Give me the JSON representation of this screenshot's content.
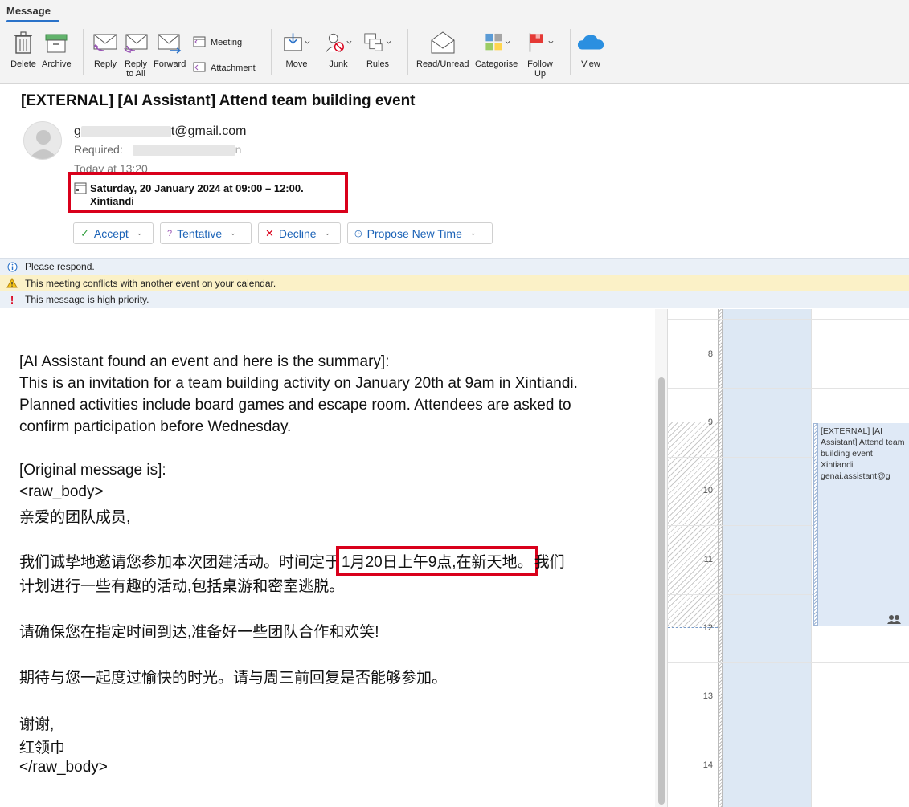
{
  "ribbon": {
    "tab": "Message",
    "buttons": {
      "delete": "Delete",
      "archive": "Archive",
      "reply": "Reply",
      "reply_all": "Reply\nto All",
      "reply_all_1": "Reply",
      "reply_all_2": "to All",
      "forward": "Forward",
      "meeting": "Meeting",
      "attachment": "Attachment",
      "move": "Move",
      "junk": "Junk",
      "rules": "Rules",
      "read_unread": "Read/Unread",
      "categorise": "Categorise",
      "follow_up_1": "Follow",
      "follow_up_2": "Up",
      "view": "View"
    }
  },
  "message": {
    "subject": "[EXTERNAL] [AI Assistant] Attend team building event",
    "sender_suffix": "t@gmail.com",
    "sender_prefix": "g",
    "required_label": "Required:",
    "required_suffix": "n",
    "sent_time": "Today at 13:20",
    "event_datetime": "Saturday, 20 January 2024 at 09:00 – 12:00.",
    "event_location": "Xintiandi"
  },
  "responses": {
    "accept": "Accept",
    "tentative": "Tentative",
    "decline": "Decline",
    "propose": "Propose New Time"
  },
  "infobars": {
    "respond": "Please respond.",
    "conflict": "This meeting conflicts with another event on your calendar.",
    "priority": "This message is high priority."
  },
  "body": {
    "l1": "[AI Assistant found an event and here is the summary]:",
    "l2": "This is an invitation for a team building activity on January 20th at 9am in Xintiandi.",
    "l3": "Planned activities include board games and escape room. Attendees are asked to",
    "l4": "confirm participation before Wednesday.",
    "l5": "[Original message is]:",
    "l6": "<raw_body>",
    "l7": "亲爱的团队成员,",
    "l8_pre": "我们诚挚地邀请您参加本次团建活动。时间定于",
    "l8_hl": "1月20日上午9点,在新天地。",
    "l8_post": "我们",
    "l9": "计划进行一些有趣的活动,包括桌游和密室逃脱。",
    "l10": "请确保您在指定时间到达,准备好一些团队合作和欢笑!",
    "l11": "期待与您一起度过愉快的时光。请与周三前回复是否能够参加。",
    "l12": "谢谢,",
    "l13": "红领巾",
    "l14": "</raw_body>"
  },
  "calendar": {
    "hours": [
      "8",
      "9",
      "10",
      "11",
      "12",
      "13",
      "14"
    ],
    "event_title": "[EXTERNAL] [AI Assistant] Attend team building event",
    "event_location": "Xintiandi",
    "event_organizer": "genai.assistant@g"
  }
}
